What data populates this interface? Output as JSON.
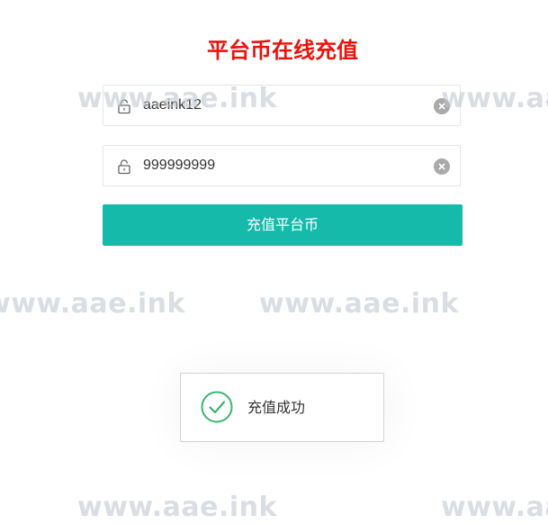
{
  "form": {
    "title": "平台币在线充值",
    "username": {
      "value": "aaeink12",
      "icon": "lock-icon",
      "clear_icon": "clear-icon"
    },
    "amount": {
      "value": "999999999",
      "icon": "lock-icon",
      "clear_icon": "clear-icon"
    },
    "submit_label": "充值平台币"
  },
  "toast": {
    "message": "充值成功",
    "icon": "check-circle-icon"
  },
  "watermark": {
    "text": "www.aae.ink"
  },
  "colors": {
    "title": "#e8140c",
    "button": "#16baaa",
    "success_icon": "#3cb371"
  }
}
